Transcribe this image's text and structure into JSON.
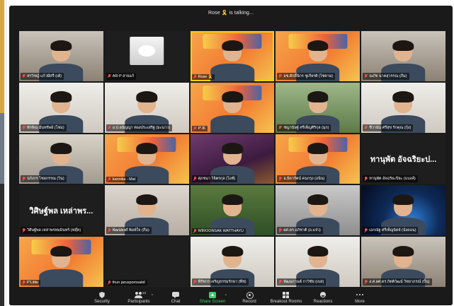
{
  "meeting": {
    "talking_banner": "Rose 🎗️ is talking..."
  },
  "participants": [
    {
      "name": "สรวิชญ์ แก้วมีศรี (เต้)",
      "bg": "bg-room"
    },
    {
      "name": "AR-P สายแก้",
      "bg": "bg-dark",
      "type": "cat"
    },
    {
      "name": "Rose 🎗️",
      "bg": "bg-orange",
      "active": true
    },
    {
      "name": "อช.ศักดิ์นิกร ชูเกียรติ (ไซตาม)",
      "bg": "bg-orange"
    },
    {
      "name": "ณภัช นาคสุวรรณ (ภีม)",
      "bg": "bg-room"
    },
    {
      "name": "ทักษิณ มั่นทรัพย์ (โฟม)",
      "bg": "bg-light"
    },
    {
      "name": "อ.ป.อนัญญา ทองประเสริฐ (มะนาว)",
      "bg": "bg-light"
    },
    {
      "name": "P'J6",
      "bg": "bg-orange"
    },
    {
      "name": "ชญานิษฐ์ ศรีเพ็ญศิริกุล (มุก)",
      "bg": "bg-green"
    },
    {
      "name": "ชีวานัน ศรีสุข รักคุณ (กุ้ง)",
      "bg": "bg-light"
    },
    {
      "name": "ปภังกร ไชยกรรณ (วิน)",
      "bg": "bg-classroom"
    },
    {
      "name": "kannika - Mat",
      "bg": "bg-orange"
    },
    {
      "name": "ศุภชนา วิจิตรกุล (ไอซ์)",
      "bg": "bg-purple"
    },
    {
      "name": "อ.ธิดารัตน์ คนกรุง (อนิน)",
      "bg": "bg-orange"
    },
    {
      "name": "ทานุพัต อัจฉริยะปิยะ (แบงค์)",
      "bg": "bg-dark",
      "big": "ทานุพัต อัจฉริยะป..."
    },
    {
      "name": "วิศิษฐ์พล เหล่าพรหมมินทร์ (ฟลุ๊ค)",
      "bg": "bg-dark",
      "big": "วิศิษฐ์พล เหล่าพร..."
    },
    {
      "name": "พัฒนพงศ์ พิมพ์ใจ (ภีม)",
      "bg": "bg-wall"
    },
    {
      "name": "WIROONSAK WATTHAYU",
      "bg": "bg-forest"
    },
    {
      "name": "ผศ.ดร.อภิชาติ (อ.แจ๋ว)",
      "bg": "bg-gray"
    },
    {
      "name": "เอกณัฐ ศรีเพ็ญนิตย์ (นั่งดอน)",
      "bg": "bg-space"
    },
    {
      "name": "P'Little",
      "bg": "bg-orange"
    },
    {
      "name": "thun jaruspornsatid",
      "bg": "bg-dark",
      "empty": true
    },
    {
      "name": "พีรัชกร เจริญธรรมรักษา (พีช)",
      "bg": "bg-light"
    },
    {
      "name": "พัฒนกานต์ กาวิชัย (เบส)",
      "bg": "bg-light"
    },
    {
      "name": "อ.ศ.ผศ.ดร.กิตติวัฒน์ วิทยาภรณ์ (ปั้น)",
      "bg": "bg-room"
    }
  ],
  "toolbar": {
    "security": "Security",
    "participants": "Participants",
    "participants_count": "33",
    "chat": "Chat",
    "share": "Share Screen",
    "record": "Record",
    "rooms": "Breakout Rooms",
    "reactions": "Reactions",
    "more": "More"
  },
  "colors": {
    "active_speaker": "#f5d300",
    "share_green": "#3ecf6a",
    "muted_red": "#ff4b4b"
  }
}
